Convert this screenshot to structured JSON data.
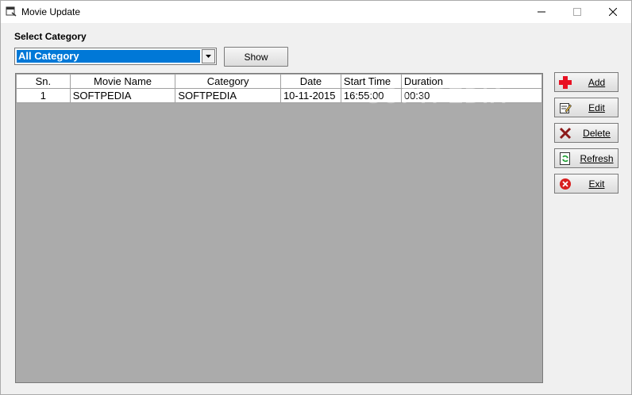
{
  "window": {
    "title": "Movie Update"
  },
  "filter": {
    "label": "Select Category",
    "selected": "All Category",
    "show_label": "Show"
  },
  "grid": {
    "columns": [
      "Sn.",
      "Movie Name",
      "Category",
      "Date",
      "Start Time",
      "Duration"
    ],
    "rows": [
      [
        "1",
        "SOFTPEDIA",
        "SOFTPEDIA",
        "10-11-2015",
        "16:55:00",
        "00:30"
      ]
    ]
  },
  "actions": {
    "add_label": "Add",
    "edit_label": "Edit",
    "delete_label": "Delete",
    "refresh_label": "Refresh",
    "exit_label": "Exit"
  },
  "watermark": "SOFTPEDIA",
  "colors": {
    "selection": "#0078d7",
    "grid_background": "#ababab",
    "add_icon": "#e81123",
    "delete_icon": "#8b1a1a",
    "exit_icon": "#d81e1e"
  }
}
